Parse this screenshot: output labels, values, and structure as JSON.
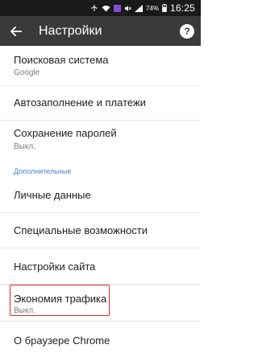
{
  "status_bar": {
    "battery_percent": "74%",
    "time": "16:25"
  },
  "toolbar": {
    "title": "Настройки",
    "help_label": "?"
  },
  "settings": {
    "items": [
      {
        "label": "Поисковая система",
        "sub": "Google"
      },
      {
        "label": "Автозаполнение и платежи"
      },
      {
        "label": "Сохранение паролей",
        "sub": "Выкл."
      },
      {
        "label": "Личные данные"
      },
      {
        "label": "Специальные возможности"
      },
      {
        "label": "Настройки сайта"
      },
      {
        "label": "Экономия трафика",
        "sub": "Выкл."
      },
      {
        "label": "О браузере Chrome"
      }
    ],
    "section_advanced": "Дополнительные"
  },
  "colors": {
    "toolbar_bg": "#3a3a3a",
    "status_bar_bg": "#1a1a1a",
    "accent": "#4a7fd8",
    "highlight": "#e0262a"
  }
}
